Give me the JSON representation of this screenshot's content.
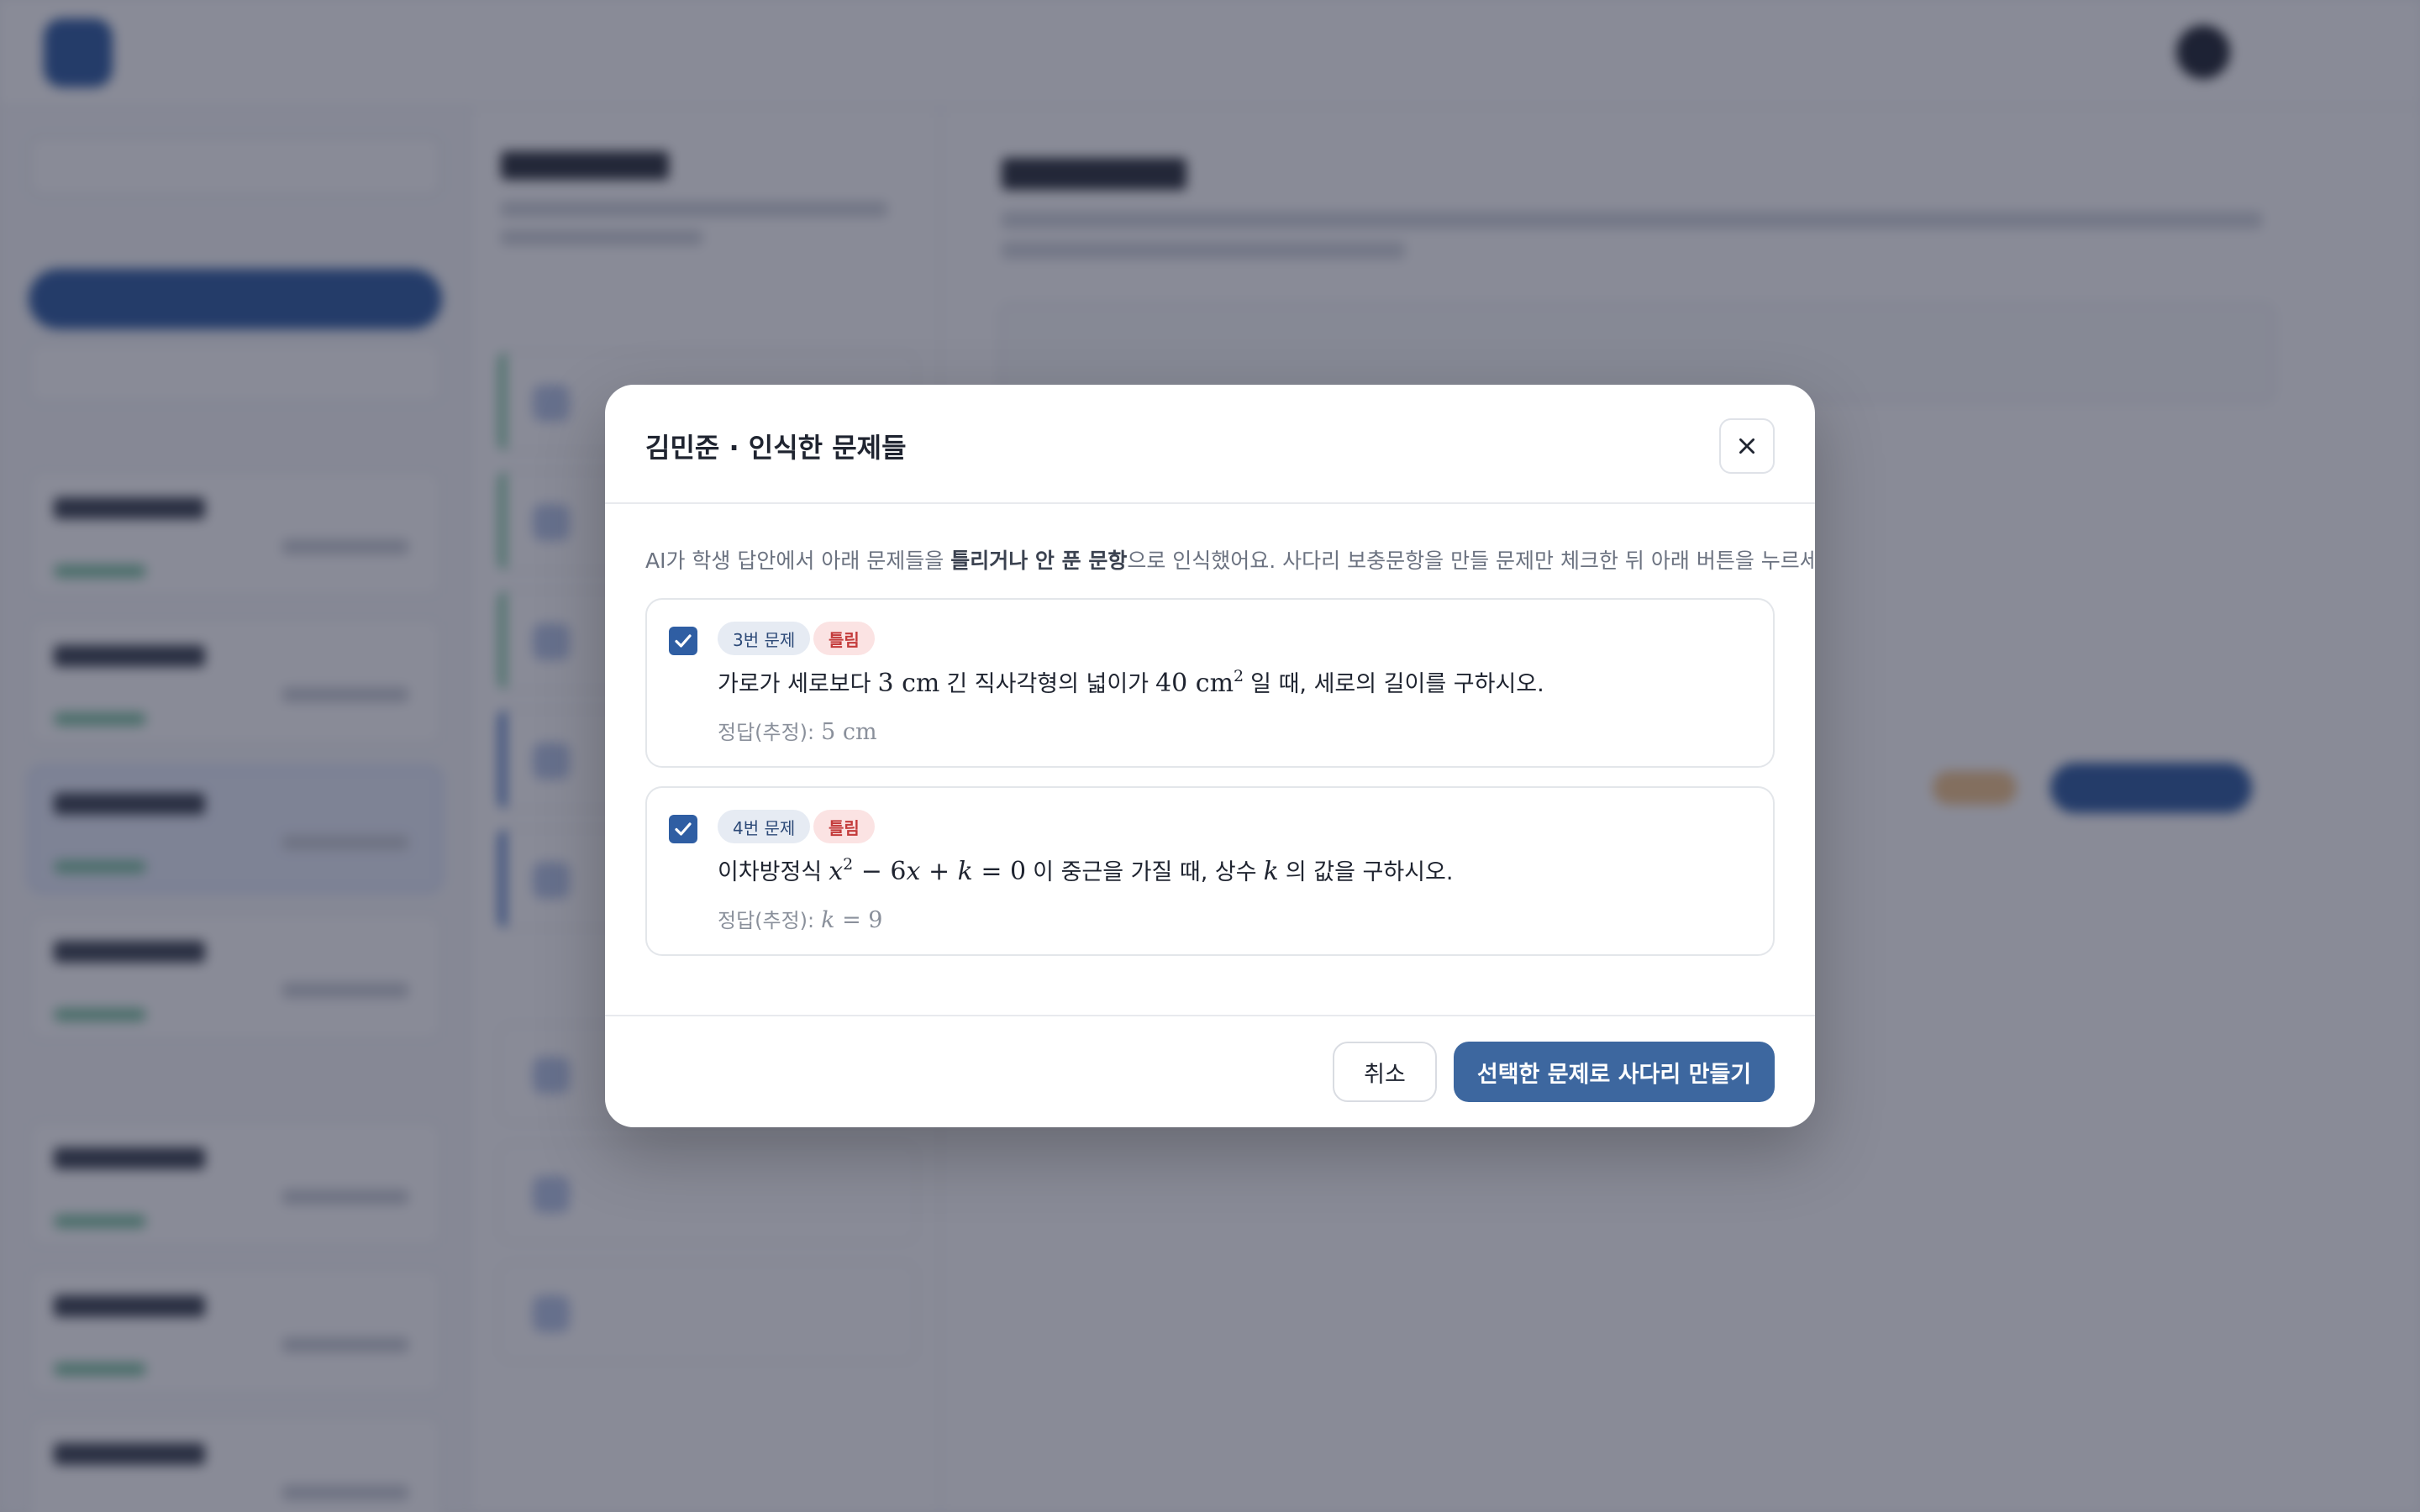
{
  "modal": {
    "title": "김민준 · 인식한 문제들",
    "intro_before": "AI가 학생 답안에서 아래 문제들을 ",
    "intro_bold": "틀리거나 안 푼 문항",
    "intro_after": "으로 인식했어요. 사다리 보충문항을 만들 문제만 체크한 뒤 아래 버튼을 누르세요.",
    "problems": [
      {
        "checked": true,
        "number_badge": "3번 문제",
        "status_badge": "틀림",
        "text_1": "가로가 세로보다",
        "math_1": "3 cm",
        "text_2": "긴 직사각형의 넓이가",
        "math_2": "40 cm",
        "math_2_sup": "2",
        "text_3": "일 때, 세로의 길이를 구하시오.",
        "answer_label": "정답(추정):",
        "answer_value": "5 cm"
      },
      {
        "checked": true,
        "number_badge": "4번 문제",
        "status_badge": "틀림",
        "text_1": "이차방정식",
        "math_1_var": "x",
        "math_1_sup": "2",
        "math_1_rest_a": " − 6",
        "math_1_var2": "x",
        "math_1_rest_b": " + ",
        "math_1_var3": "k",
        "math_1_rest_c": " = 0",
        "text_2": "이 중근을 가질 때, 상수",
        "math_2": "k",
        "text_3": "의 값을 구하시오.",
        "answer_label": "정답(추정):",
        "answer_var": "k",
        "answer_rest": " = 9"
      }
    ],
    "cancel_label": "취소",
    "confirm_label": "선택한 문제로 사다리 만들기"
  },
  "colors": {
    "primary": "#3d679f",
    "checkbox": "#2f5ea3",
    "wrong_badge_bg": "#fbe3e3",
    "wrong_badge_text": "#c43b3b",
    "overlay": "rgba(28,32,56,0.52)"
  },
  "icons": {
    "close": "close-icon",
    "check": "check-icon"
  }
}
